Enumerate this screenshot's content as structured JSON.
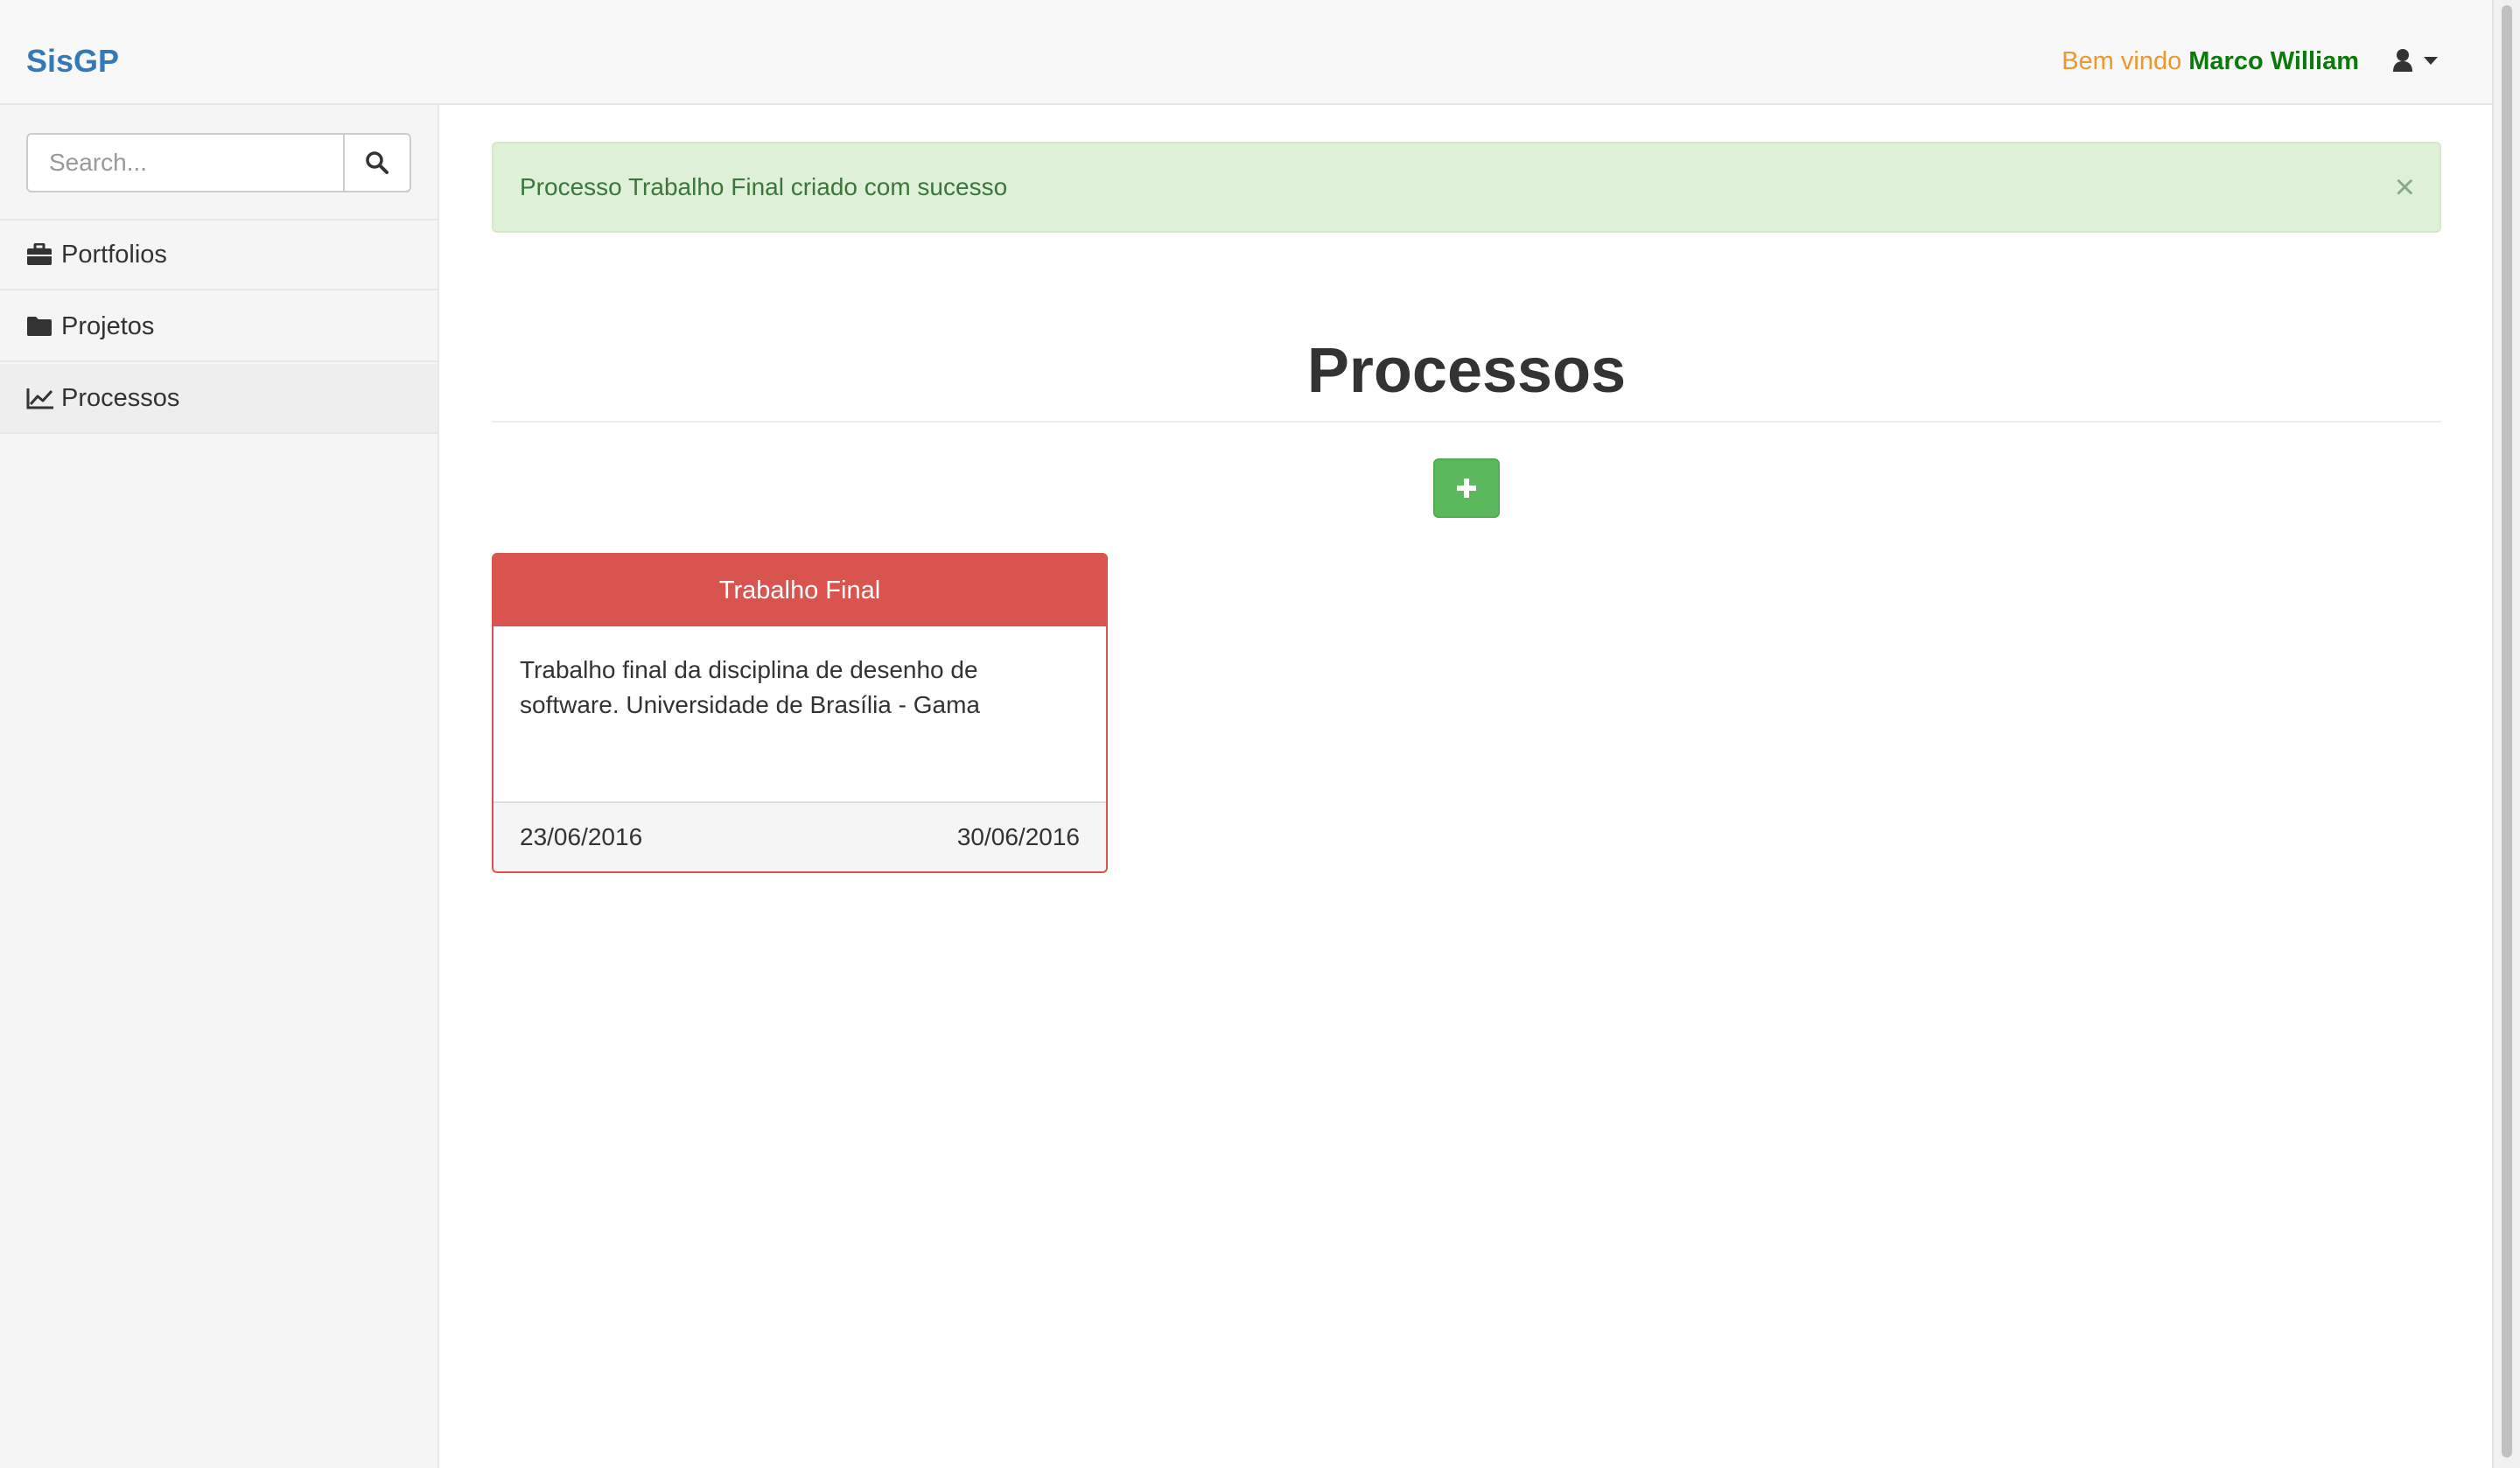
{
  "navbar": {
    "brand": "SisGP",
    "welcome_prefix": "Bem vindo",
    "user_name": "Marco William",
    "user_icon": "user-icon",
    "caret_icon": "caret-down-icon"
  },
  "sidebar": {
    "search": {
      "placeholder": "Search...",
      "value": "",
      "icon": "search-icon"
    },
    "items": [
      {
        "label": "Portfolios",
        "icon": "briefcase-icon",
        "active": false
      },
      {
        "label": "Projetos",
        "icon": "folder-icon",
        "active": false
      },
      {
        "label": "Processos",
        "icon": "line-chart-icon",
        "active": true
      }
    ]
  },
  "alert": {
    "message": "Processo Trabalho Final criado com sucesso",
    "close_symbol": "×"
  },
  "main": {
    "title": "Processos",
    "add_button_icon": "plus-icon"
  },
  "processes": [
    {
      "name": "Trabalho Final",
      "description": "Trabalho final da disciplina de desenho de software. Universidade de Brasília - Gama",
      "start_date": "23/06/2016",
      "end_date": "30/06/2016"
    }
  ],
  "colors": {
    "brand": "#337ab7",
    "welcome": "#f0962c",
    "user_name": "#0a7a0a",
    "success_bg": "#dff0d8",
    "success_text": "#3c763d",
    "add_button": "#5cb85c",
    "card_header": "#d9534f"
  }
}
